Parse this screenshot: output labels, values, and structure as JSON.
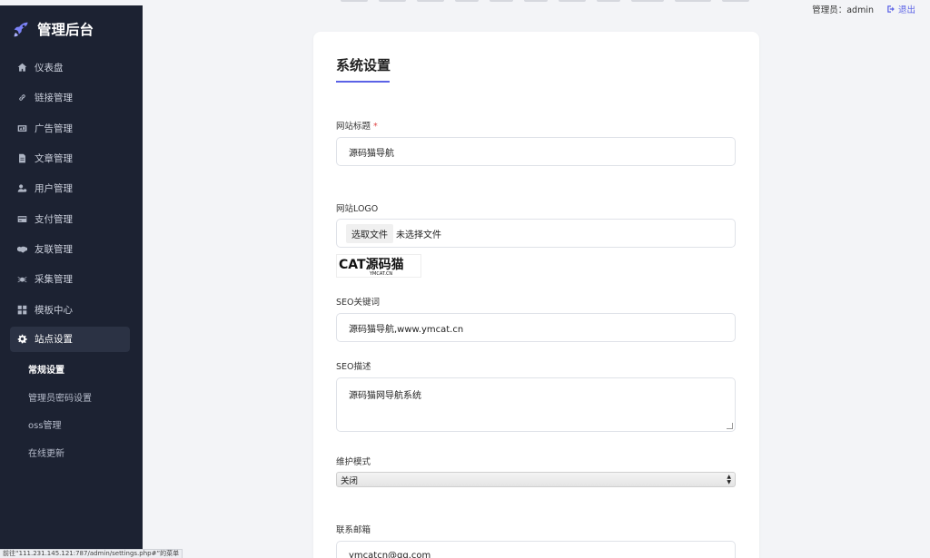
{
  "sidebar": {
    "brand": "管理后台",
    "items": [
      {
        "label": "仪表盘",
        "icon": "home-icon"
      },
      {
        "label": "链接管理",
        "icon": "link-icon"
      },
      {
        "label": "广告管理",
        "icon": "ad-icon"
      },
      {
        "label": "文章管理",
        "icon": "file-icon"
      },
      {
        "label": "用户管理",
        "icon": "user-cog-icon"
      },
      {
        "label": "支付管理",
        "icon": "credit-card-icon"
      },
      {
        "label": "友联管理",
        "icon": "handshake-icon"
      },
      {
        "label": "采集管理",
        "icon": "spider-icon"
      },
      {
        "label": "模板中心",
        "icon": "grid-icon"
      },
      {
        "label": "站点设置",
        "icon": "gear-icon"
      }
    ],
    "subitems": [
      {
        "label": "常规设置"
      },
      {
        "label": "管理员密码设置"
      },
      {
        "label": "oss管理"
      },
      {
        "label": "在线更新"
      }
    ]
  },
  "topbar": {
    "user_label": "管理员：admin",
    "logout_label": "退出"
  },
  "form": {
    "title": "系统设置",
    "site_title": {
      "label": "网站标题",
      "required_mark": "*",
      "value": "源码猫导航"
    },
    "site_logo": {
      "label": "网站LOGO",
      "button": "选取文件",
      "status": "未选择文件",
      "logo_text": "CAT源码猫",
      "logo_sub": "YMCAT.CN"
    },
    "seo_keywords": {
      "label": "SEO关键词",
      "value": "源码猫导航,www.ymcat.cn"
    },
    "seo_desc": {
      "label": "SEO描述",
      "value": "源码猫网导航系统"
    },
    "maintenance": {
      "label": "维护模式",
      "value": "关闭"
    },
    "email": {
      "label": "联系邮箱",
      "value": "ymcatcn@qq.com"
    }
  },
  "statusbar": {
    "text": "前往“111.231.145.121:787/admin/settings.php#”的菜单"
  },
  "colors": {
    "sidebar_bg": "#1c2232",
    "accent": "#5b62e6",
    "page_bg": "#f3f4f7"
  }
}
